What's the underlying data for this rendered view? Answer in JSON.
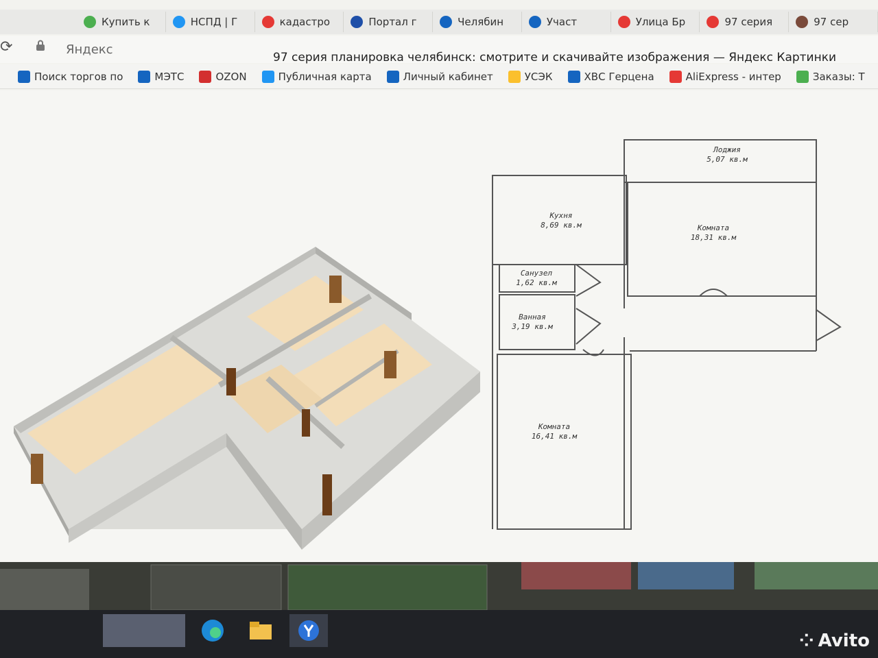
{
  "tabs": [
    {
      "label": "Купить к",
      "icon": "app-icon",
      "color": "#4caf50"
    },
    {
      "label": "НСПД | Г",
      "icon": "globe-icon",
      "color": "#2196f3"
    },
    {
      "label": "кадастро",
      "icon": "yandex-icon",
      "color": "#e53935"
    },
    {
      "label": "Портал г",
      "icon": "flag-icon",
      "color": "#1e4fa8"
    },
    {
      "label": "Челябин",
      "icon": "bird-icon",
      "color": "#1565c0"
    },
    {
      "label": "Участ",
      "icon": "bird-icon",
      "color": "#1565c0"
    },
    {
      "label": "Улица Бр",
      "icon": "pin-icon",
      "color": "#e53935"
    },
    {
      "label": "97 серия",
      "icon": "yandex-icon",
      "color": "#e53935"
    },
    {
      "label": "97 сер",
      "icon": "avatar-icon",
      "color": "#7a4a3a"
    }
  ],
  "address": {
    "site": "Яндекс",
    "page_title": "97 серия планировка челябинск: смотрите и скачивайте изображения — Яндекс Картинки"
  },
  "bookmarks": [
    {
      "label": "Поиск торгов по",
      "icon": "bird-icon",
      "color": "#1565c0"
    },
    {
      "label": "МЭТС",
      "icon": "mets-icon",
      "color": "#1565c0"
    },
    {
      "label": "OZON",
      "icon": "ozon-icon",
      "color": "#d32f2f"
    },
    {
      "label": "Публичная карта",
      "icon": "map-icon",
      "color": "#2196f3"
    },
    {
      "label": "Личный кабинет",
      "icon": "bird-icon",
      "color": "#1565c0"
    },
    {
      "label": "УСЭК",
      "icon": "bulb-icon",
      "color": "#fbc02d"
    },
    {
      "label": "ХВС Герцена",
      "icon": "doc-icon",
      "color": "#1565c0"
    },
    {
      "label": "AliExpress - интер",
      "icon": "aliexpress-icon",
      "color": "#e53935"
    },
    {
      "label": "Заказы: Т",
      "icon": "app-icon",
      "color": "#4caf50"
    }
  ],
  "floorplan": {
    "rooms": [
      {
        "name": "Лоджия",
        "area": "5,07 кв.м"
      },
      {
        "name": "Кухня",
        "area": "8,69 кв.м"
      },
      {
        "name": "Комната",
        "area": "18,31 кв.м"
      },
      {
        "name": "Санузел",
        "area": "1,62 кв.м"
      },
      {
        "name": "Ванная",
        "area": "3,19 кв.м"
      },
      {
        "name": "Комната",
        "area": "16,41 кв.м"
      }
    ]
  },
  "watermark": {
    "text": "Avito"
  }
}
